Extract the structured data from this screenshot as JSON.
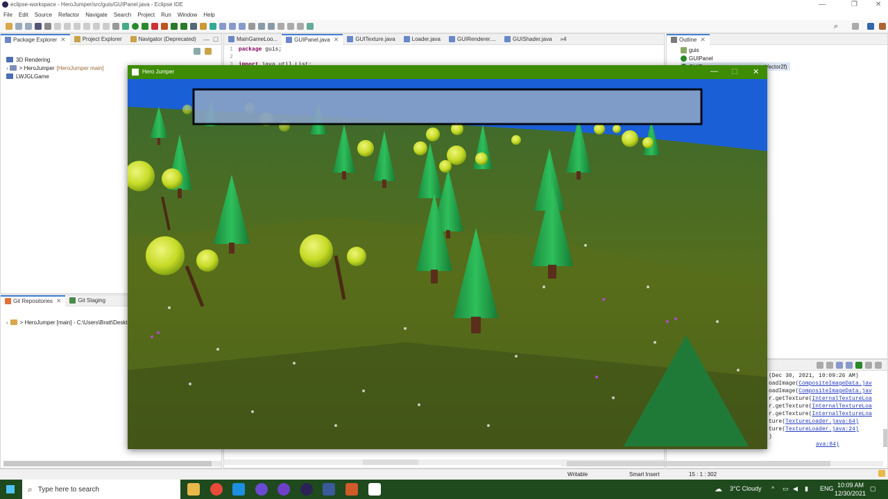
{
  "app": {
    "title": "eclipse-workspace - HeroJumper/src/guis/GUIPanel.java - Eclipse IDE",
    "minimize": "—",
    "maximize": "❐",
    "close": "✕"
  },
  "menu": [
    "File",
    "Edit",
    "Source",
    "Refactor",
    "Navigate",
    "Search",
    "Project",
    "Run",
    "Window",
    "Help"
  ],
  "left_panel": {
    "tabs": [
      {
        "label": "Package Explorer",
        "icon": "package-explorer-icon"
      },
      {
        "label": "Project Explorer",
        "icon": "project-explorer-icon"
      },
      {
        "label": "Navigator (Deprecated)",
        "icon": "navigator-icon"
      }
    ],
    "tree": [
      {
        "label": "3D Rendering",
        "decoration": ""
      },
      {
        "label": "> HeroJumper",
        "decoration": "[HeroJumper main]"
      },
      {
        "label": "LWJGLGame",
        "decoration": ""
      }
    ]
  },
  "git_panel": {
    "tabs": [
      {
        "label": "Git Repositories",
        "icon": "git-repositories-icon"
      },
      {
        "label": "Git Staging",
        "icon": "git-staging-icon"
      }
    ],
    "tree": [
      {
        "label": "> HeroJumper [main] - C:\\Users\\Bratt\\Deskto"
      }
    ]
  },
  "editor": {
    "tabs": [
      {
        "label": "MainGameLoo..."
      },
      {
        "label": "GUIPanel.java",
        "active": true
      },
      {
        "label": "GUITexture.java"
      },
      {
        "label": "Loader.java"
      },
      {
        "label": "GUIRenderer...."
      },
      {
        "label": "GUIShader.java"
      },
      {
        "label": "»4"
      }
    ],
    "lines": [
      {
        "num": "1",
        "keyword": "package",
        "text": " guis;"
      },
      {
        "num": "2",
        "keyword": "",
        "text": ""
      },
      {
        "num": "3",
        "keyword": "import",
        "text": " java.util.List;"
      }
    ]
  },
  "outline": {
    "tab": "Outline",
    "items": [
      {
        "label": "guis"
      },
      {
        "label": "GUIPanel"
      },
      {
        "label": "GUIP",
        "detail": "Vector2f)"
      }
    ]
  },
  "console": {
    "header": "(Dec 30, 2021, 10:09:26 AM)",
    "lines": [
      {
        "prefix": "oadImage(",
        "link": "CompositeImageData.jav"
      },
      {
        "prefix": "oadImage(",
        "link": "CompositeImageData.jav"
      },
      {
        "prefix": "r.getTexture(",
        "link": "InternalTextureLoa"
      },
      {
        "prefix": "r.getTexture(",
        "link": "InternalTextureLoa"
      },
      {
        "prefix": "r.getTexture(",
        "link": "InternalTextureLoa"
      },
      {
        "prefix": "ture(",
        "link": "TextureLoader.java:64)"
      },
      {
        "prefix": "ture(",
        "link": "TextureLoader.java:24)"
      },
      {
        "prefix": ")",
        "link": ""
      },
      {
        "prefix": "",
        "link": "ava:84)"
      }
    ]
  },
  "game_window": {
    "title": "Hero Jumper",
    "minimize": "—",
    "maximize": "☐",
    "close": "✕"
  },
  "status": {
    "writable": "Writable",
    "insert_mode": "Smart Insert",
    "position": "15 : 1 : 302"
  },
  "taskbar": {
    "search_placeholder": "Type here to search",
    "weather": "3°C  Cloudy",
    "language": "ENG",
    "time": "10:09 AM",
    "date": "12/30/2021"
  },
  "colors": {
    "accent": "#3f7fd1",
    "game_titlebar": "#3d8c04",
    "sky": "#1a5fd6",
    "grass": "#4d6b1c",
    "pine": "#23a24a",
    "round_tree": "#c9e02a"
  }
}
